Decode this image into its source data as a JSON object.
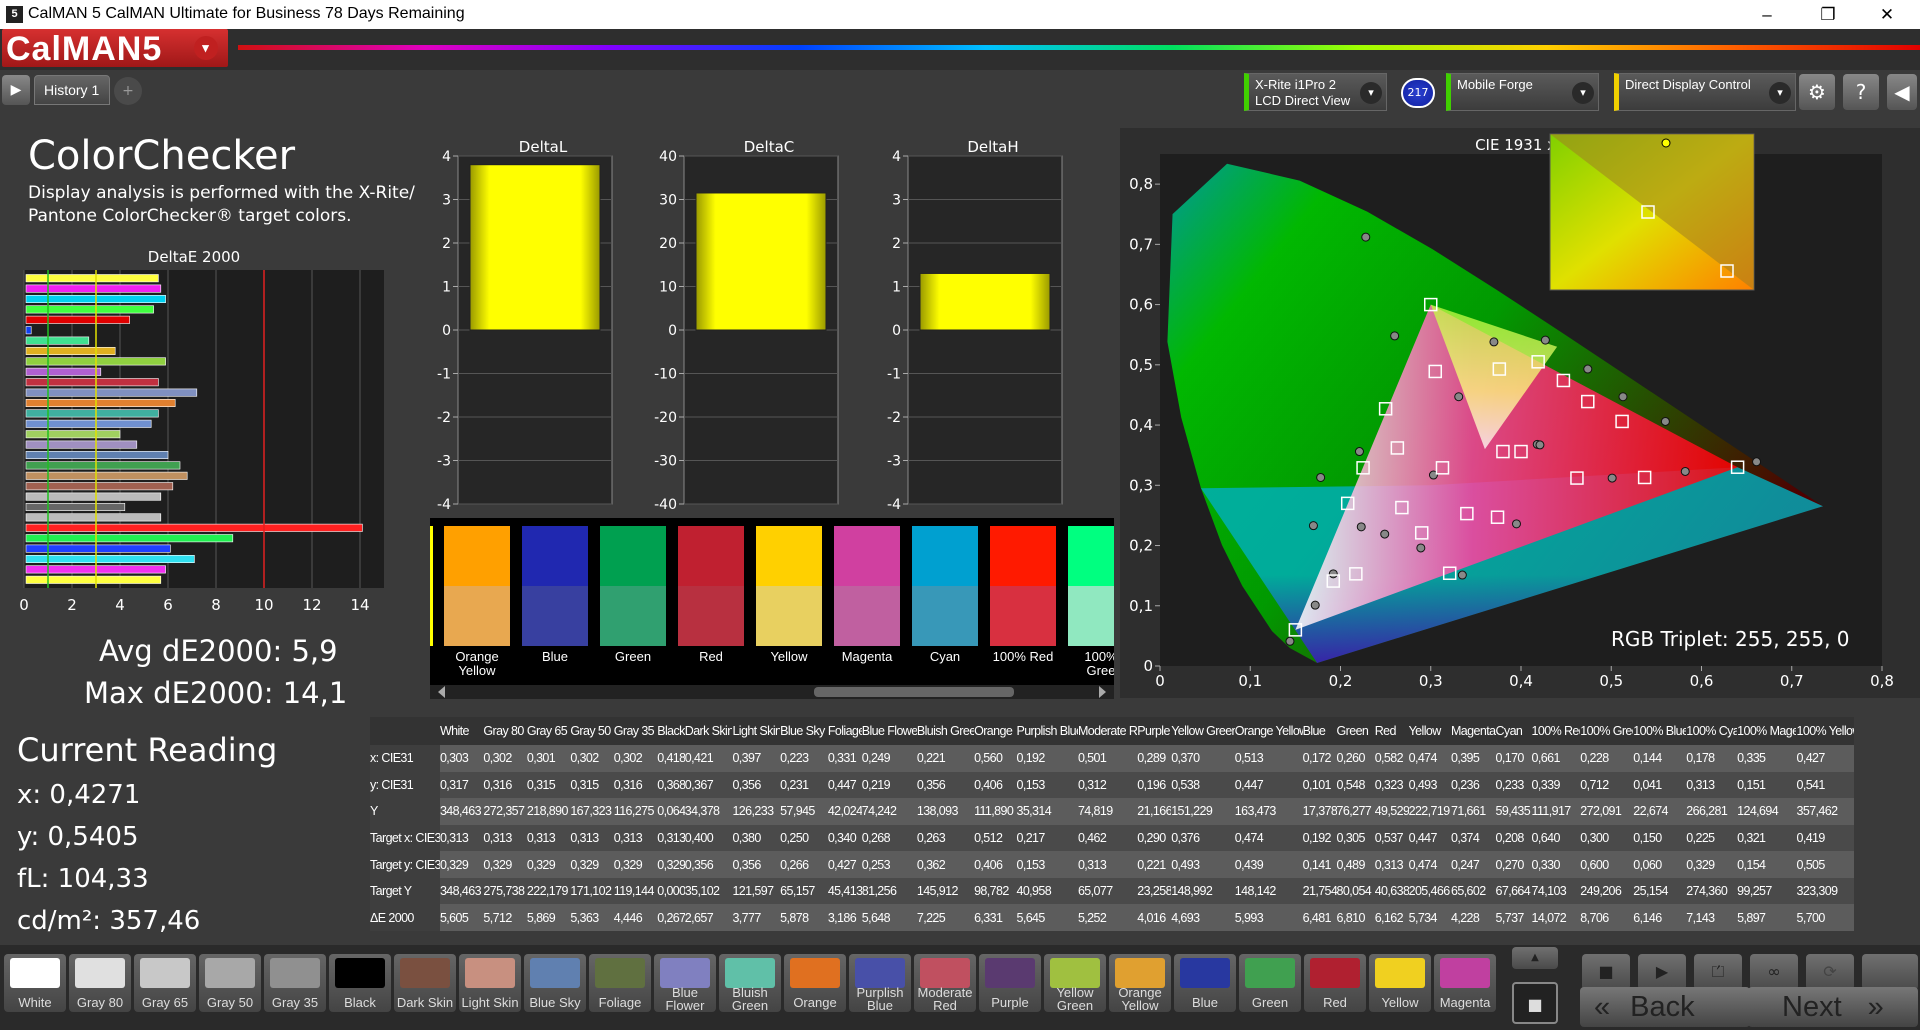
{
  "window": {
    "icon": "5",
    "title": "CalMAN 5 CalMAN Ultimate for Business 78 Days Remaining",
    "minimize": "–",
    "maximize": "❐",
    "close": "✕"
  },
  "app": {
    "logo": "CalMAN5",
    "logo_caret": "▾"
  },
  "tabs": {
    "nav_play": "▶",
    "history": "History 1",
    "add": "+"
  },
  "devices": {
    "meter": {
      "line1": "X-Rite i1Pro 2",
      "line2": "LCD Direct View"
    },
    "meter_badge": "217",
    "source": {
      "line1": "Mobile Forge"
    },
    "display": {
      "line1": "Direct Display Control"
    },
    "dropdown": "▾",
    "settings": "⚙",
    "help": "?",
    "collapse": "◀"
  },
  "left": {
    "title": "ColorChecker",
    "desc1": "Display analysis is performed with the X-Rite/",
    "desc2": "Pantone ColorChecker® target colors.",
    "avg": "Avg dE2000: 5,9",
    "max": "Max dE2000: 14,1"
  },
  "current": {
    "title": "Current Reading",
    "x": "x: 0,4271",
    "y": "y: 0,5405",
    "fl": "fL: 104,33",
    "cdm2": "cd/m²: 357,46"
  },
  "deltae_chart": {
    "title": "DeltaE 2000",
    "ticks": [
      "0",
      "2",
      "4",
      "6",
      "8",
      "10",
      "12",
      "14"
    ],
    "values": [
      5.6,
      5.7,
      5.9,
      5.4,
      4.4,
      0.3,
      2.7,
      3.8,
      5.9,
      3.2,
      5.6,
      7.2,
      6.3,
      5.6,
      5.3,
      4.0,
      4.7,
      6.0,
      6.5,
      6.8,
      6.2,
      5.7,
      4.2,
      5.7,
      14.1,
      8.7,
      6.1,
      7.1,
      5.9,
      5.7
    ],
    "colors": [
      "#ffff40",
      "#f020f0",
      "#00d0f0",
      "#40ff40",
      "#e00000",
      "#1040f0",
      "#40e090",
      "#e0b020",
      "#90d040",
      "#b060d0",
      "#c03040",
      "#8090c0",
      "#e08030",
      "#40b0a0",
      "#7090d0",
      "#a0d060",
      "#a090c0",
      "#6080b0",
      "#40a050",
      "#c09060",
      "#a06050",
      "#bbbbbb",
      "#666666",
      "#bbbbbb",
      "#ff2020",
      "#20f050",
      "#2040ff",
      "#30e0f0",
      "#f030f0",
      "#ffff40"
    ],
    "ref_lines": [
      {
        "value": 1,
        "color": "#20c020"
      },
      {
        "value": 3,
        "color": "#e0e000"
      },
      {
        "value": 10,
        "color": "#e02020"
      }
    ]
  },
  "delta_charts": [
    {
      "title": "DeltaL",
      "ticks": [
        "4",
        "3",
        "2",
        "1",
        "0",
        "-1",
        "-2",
        "-3",
        "-4"
      ],
      "value": 3.8,
      "max": 4
    },
    {
      "title": "DeltaC",
      "ticks": [
        "40",
        "30",
        "20",
        "10",
        "0",
        "-10",
        "-20",
        "-30",
        "-40"
      ],
      "value": 31.5,
      "max": 40
    },
    {
      "title": "DeltaH",
      "ticks": [
        "4",
        "3",
        "2",
        "1",
        "0",
        "-1",
        "-2",
        "-3",
        "-4"
      ],
      "value": 1.3,
      "max": 4
    }
  ],
  "swatches": [
    {
      "label": "Orange\nYellow",
      "top": "#ffa000",
      "bot": "#e8a850"
    },
    {
      "label": "Blue",
      "top": "#2028b0",
      "bot": "#3840a0"
    },
    {
      "label": "Green",
      "top": "#00a050",
      "bot": "#30a070"
    },
    {
      "label": "Red",
      "top": "#c02030",
      "bot": "#b83040"
    },
    {
      "label": "Yellow",
      "top": "#ffd000",
      "bot": "#e8d060"
    },
    {
      "label": "Magenta",
      "top": "#d040a0",
      "bot": "#c060a0"
    },
    {
      "label": "Cyan",
      "top": "#00a0d0",
      "bot": "#3898b8"
    },
    {
      "label": "100% Red",
      "top": "#ff1a00",
      "bot": "#d83040"
    },
    {
      "label": "100%\nGree",
      "top": "#00ff80",
      "bot": "#90e8c0"
    }
  ],
  "cie": {
    "title": "CIE 1931 xy",
    "x_ticks": [
      "0",
      "0,1",
      "0,2",
      "0,3",
      "0,4",
      "0,5",
      "0,6",
      "0,7",
      "0,8"
    ],
    "y_ticks": [
      "0,8",
      "0,7",
      "0,6",
      "0,5",
      "0,4",
      "0,3",
      "0,2",
      "0,1",
      "0"
    ],
    "rgb_triplet": "RGB Triplet: 255, 255, 0",
    "targets": [
      [
        0.313,
        0.329
      ],
      [
        0.4,
        0.356
      ],
      [
        0.25,
        0.427
      ],
      [
        0.34,
        0.253
      ],
      [
        0.268,
        0.263
      ],
      [
        0.512,
        0.406
      ],
      [
        0.217,
        0.153
      ],
      [
        0.462,
        0.312
      ],
      [
        0.29,
        0.221
      ],
      [
        0.376,
        0.493
      ],
      [
        0.474,
        0.439
      ],
      [
        0.192,
        0.141
      ],
      [
        0.305,
        0.489
      ],
      [
        0.537,
        0.313
      ],
      [
        0.447,
        0.474
      ],
      [
        0.374,
        0.247
      ],
      [
        0.208,
        0.27
      ],
      [
        0.64,
        0.33
      ],
      [
        0.3,
        0.6
      ],
      [
        0.15,
        0.06
      ],
      [
        0.225,
        0.329
      ],
      [
        0.321,
        0.154
      ],
      [
        0.419,
        0.505
      ],
      [
        0.38,
        0.356
      ],
      [
        0.263,
        0.362
      ]
    ],
    "measured": [
      [
        0.303,
        0.317
      ],
      [
        0.418,
        0.368
      ],
      [
        0.223,
        0.231
      ],
      [
        0.331,
        0.447
      ],
      [
        0.249,
        0.219
      ],
      [
        0.56,
        0.406
      ],
      [
        0.192,
        0.153
      ],
      [
        0.501,
        0.312
      ],
      [
        0.289,
        0.196
      ],
      [
        0.37,
        0.538
      ],
      [
        0.513,
        0.447
      ],
      [
        0.172,
        0.101
      ],
      [
        0.26,
        0.548
      ],
      [
        0.582,
        0.323
      ],
      [
        0.474,
        0.493
      ],
      [
        0.395,
        0.236
      ],
      [
        0.17,
        0.233
      ],
      [
        0.661,
        0.339
      ],
      [
        0.228,
        0.712
      ],
      [
        0.144,
        0.041
      ],
      [
        0.178,
        0.313
      ],
      [
        0.335,
        0.151
      ],
      [
        0.427,
        0.541
      ],
      [
        0.421,
        0.367
      ],
      [
        0.221,
        0.356
      ]
    ]
  },
  "table": {
    "headers": [
      "",
      "White",
      "Gray 80",
      "Gray 65",
      "Gray 50",
      "Gray 35",
      "Black",
      "Dark Skin",
      "Light Skin",
      "Blue Sky",
      "Foliage",
      "Blue Flower",
      "Bluish Green",
      "Orange",
      "Purplish Blue",
      "Moderate Red",
      "Purple",
      "Yellow Green",
      "Orange Yellow",
      "Blue",
      "Green",
      "Red",
      "Yellow",
      "Magenta",
      "Cyan",
      "100% Red",
      "100% Green",
      "100% Blue",
      "100% Cyan",
      "100% Magenta",
      "100% Yellow"
    ],
    "rows": [
      [
        "x: CIE31",
        "0,303",
        "0,302",
        "0,301",
        "0,302",
        "0,302",
        "0,418",
        "0,421",
        "0,397",
        "0,223",
        "0,331",
        "0,249",
        "0,221",
        "0,560",
        "0,192",
        "0,501",
        "0,289",
        "0,370",
        "0,513",
        "0,172",
        "0,260",
        "0,582",
        "0,474",
        "0,395",
        "0,170",
        "0,661",
        "0,228",
        "0,144",
        "0,178",
        "0,335",
        "0,427"
      ],
      [
        "y: CIE31",
        "0,317",
        "0,316",
        "0,315",
        "0,315",
        "0,316",
        "0,368",
        "0,367",
        "0,356",
        "0,231",
        "0,447",
        "0,219",
        "0,356",
        "0,406",
        "0,153",
        "0,312",
        "0,196",
        "0,538",
        "0,447",
        "0,101",
        "0,548",
        "0,323",
        "0,493",
        "0,236",
        "0,233",
        "0,339",
        "0,712",
        "0,041",
        "0,313",
        "0,151",
        "0,541"
      ],
      [
        "Y",
        "348,463",
        "272,357",
        "218,890",
        "167,323",
        "116,275",
        "0,064",
        "34,378",
        "126,233",
        "57,945",
        "42,024",
        "74,242",
        "138,093",
        "111,890",
        "35,314",
        "74,819",
        "21,166",
        "151,229",
        "163,473",
        "17,378",
        "76,277",
        "49,529",
        "222,719",
        "71,661",
        "59,435",
        "111,917",
        "272,091",
        "22,674",
        "266,281",
        "124,694",
        "357,462"
      ],
      [
        "Target x: CIE31",
        "0,313",
        "0,313",
        "0,313",
        "0,313",
        "0,313",
        "0,313",
        "0,400",
        "0,380",
        "0,250",
        "0,340",
        "0,268",
        "0,263",
        "0,512",
        "0,217",
        "0,462",
        "0,290",
        "0,376",
        "0,474",
        "0,192",
        "0,305",
        "0,537",
        "0,447",
        "0,374",
        "0,208",
        "0,640",
        "0,300",
        "0,150",
        "0,225",
        "0,321",
        "0,419"
      ],
      [
        "Target y: CIE31",
        "0,329",
        "0,329",
        "0,329",
        "0,329",
        "0,329",
        "0,329",
        "0,356",
        "0,356",
        "0,266",
        "0,427",
        "0,253",
        "0,362",
        "0,406",
        "0,153",
        "0,313",
        "0,221",
        "0,493",
        "0,439",
        "0,141",
        "0,489",
        "0,313",
        "0,474",
        "0,247",
        "0,270",
        "0,330",
        "0,600",
        "0,060",
        "0,329",
        "0,154",
        "0,505"
      ],
      [
        "Target Y",
        "348,463",
        "275,738",
        "222,179",
        "171,102",
        "119,144",
        "0,000",
        "35,102",
        "121,597",
        "65,157",
        "45,413",
        "81,256",
        "145,912",
        "98,782",
        "40,958",
        "65,077",
        "23,258",
        "148,992",
        "148,142",
        "21,754",
        "80,054",
        "40,638",
        "205,466",
        "65,602",
        "67,664",
        "74,103",
        "249,206",
        "25,154",
        "274,360",
        "99,257",
        "323,309"
      ],
      [
        "ΔE 2000",
        "5,605",
        "5,712",
        "5,869",
        "5,363",
        "4,446",
        "0,267",
        "2,657",
        "3,777",
        "5,878",
        "3,186",
        "5,648",
        "7,225",
        "6,331",
        "5,645",
        "5,252",
        "4,016",
        "4,693",
        "5,993",
        "6,481",
        "6,810",
        "6,162",
        "5,734",
        "4,228",
        "5,737",
        "14,072",
        "8,706",
        "6,146",
        "7,143",
        "5,897",
        "5,700"
      ]
    ]
  },
  "bottom_swatches": [
    {
      "label": "White",
      "color": "#ffffff"
    },
    {
      "label": "Gray 80",
      "color": "#e0e0e0"
    },
    {
      "label": "Gray 65",
      "color": "#c8c8c8"
    },
    {
      "label": "Gray 50",
      "color": "#a8a8a8"
    },
    {
      "label": "Gray 35",
      "color": "#909090"
    },
    {
      "label": "Black",
      "color": "#000000"
    },
    {
      "label": "Dark Skin",
      "color": "#7a5040"
    },
    {
      "label": "Light Skin",
      "color": "#c89080"
    },
    {
      "label": "Blue Sky",
      "color": "#6080b0"
    },
    {
      "label": "Foliage",
      "color": "#607040"
    },
    {
      "label": "Blue\nFlower",
      "color": "#8080c0"
    },
    {
      "label": "Bluish\nGreen",
      "color": "#60c0a8"
    },
    {
      "label": "Orange",
      "color": "#e07020"
    },
    {
      "label": "Purplish\nBlue",
      "color": "#4850a8"
    },
    {
      "label": "Moderate\nRed",
      "color": "#c05060"
    },
    {
      "label": "Purple",
      "color": "#5a3a70"
    },
    {
      "label": "Yellow\nGreen",
      "color": "#a0c040"
    },
    {
      "label": "Orange\nYellow",
      "color": "#e0a030"
    },
    {
      "label": "Blue",
      "color": "#2838a0"
    },
    {
      "label": "Green",
      "color": "#40a050"
    },
    {
      "label": "Red",
      "color": "#b02030"
    },
    {
      "label": "Yellow",
      "color": "#f0d020"
    },
    {
      "label": "Magenta",
      "color": "#c040a0"
    }
  ],
  "controls": {
    "stop": "■",
    "play": "▶",
    "step": "⏍",
    "loop": "∞",
    "refresh": "⟳",
    "record": "■",
    "back": "Back",
    "next": "Next",
    "back_chev": "«",
    "next_chev": "»",
    "up": "▲",
    "down": "▼"
  }
}
